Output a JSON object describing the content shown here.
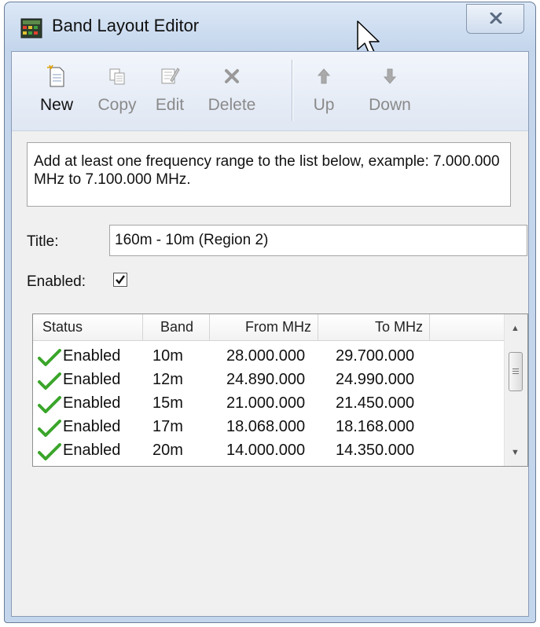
{
  "window": {
    "title": "Band Layout Editor"
  },
  "toolbar": {
    "new": "New",
    "copy": "Copy",
    "edit": "Edit",
    "delete": "Delete",
    "up": "Up",
    "down": "Down"
  },
  "info_text": "Add at least one frequency range to the list below, example: 7.000.000 MHz to 7.100.000 MHz.",
  "form": {
    "title_label": "Title:",
    "title_value": "160m - 10m (Region 2)",
    "enabled_label": "Enabled:",
    "enabled_checked": true
  },
  "list": {
    "columns": [
      "Status",
      "Band",
      "From MHz",
      "To MHz"
    ],
    "rows": [
      {
        "status": "Enabled",
        "band": "10m",
        "from": "28.000.000",
        "to": "29.700.000"
      },
      {
        "status": "Enabled",
        "band": "12m",
        "from": "24.890.000",
        "to": "24.990.000"
      },
      {
        "status": "Enabled",
        "band": "15m",
        "from": "21.000.000",
        "to": "21.450.000"
      },
      {
        "status": "Enabled",
        "band": "17m",
        "from": "18.068.000",
        "to": "18.168.000"
      },
      {
        "status": "Enabled",
        "band": "20m",
        "from": "14.000.000",
        "to": "14.350.000"
      }
    ]
  },
  "icons": {
    "app": "band-layout-app-icon",
    "close": "close-icon",
    "new": "new-document-icon",
    "copy": "copy-icon",
    "edit": "edit-icon",
    "delete": "delete-x-icon",
    "up": "arrow-up-icon",
    "down": "arrow-down-icon",
    "status_ok": "green-checkmark-icon"
  },
  "colors": {
    "titlebar": "#c4d6ec",
    "check_green": "#3aa52a"
  }
}
